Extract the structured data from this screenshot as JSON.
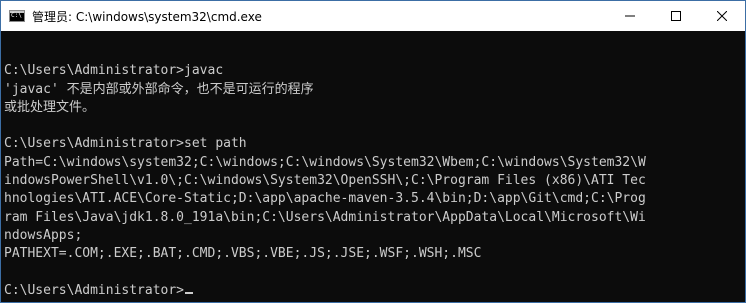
{
  "window": {
    "title": "管理员: C:\\windows\\system32\\cmd.exe",
    "icon": "cmd-icon"
  },
  "controls": {
    "minimize": "minimize-icon",
    "maximize": "maximize-icon",
    "close": "close-icon"
  },
  "console": {
    "lines": [
      "",
      "C:\\Users\\Administrator>javac",
      "'javac' 不是内部或外部命令，也不是可运行的程序",
      "或批处理文件。",
      "",
      "C:\\Users\\Administrator>set path",
      "Path=C:\\windows\\system32;C:\\windows;C:\\windows\\System32\\Wbem;C:\\windows\\System32\\W",
      "indowsPowerShell\\v1.0\\;C:\\windows\\System32\\OpenSSH\\;C:\\Program Files (x86)\\ATI Tec",
      "hnologies\\ATI.ACE\\Core-Static;D:\\app\\apache-maven-3.5.4\\bin;D:\\app\\Git\\cmd;C:\\Prog",
      "ram Files\\Java\\jdk1.8.0_191a\\bin;C:\\Users\\Administrator\\AppData\\Local\\Microsoft\\Wi",
      "ndowsApps;",
      "PATHEXT=.COM;.EXE;.BAT;.CMD;.VBS;.VBE;.JS;.JSE;.WSF;.WSH;.MSC",
      "",
      "C:\\Users\\Administrator>"
    ]
  }
}
